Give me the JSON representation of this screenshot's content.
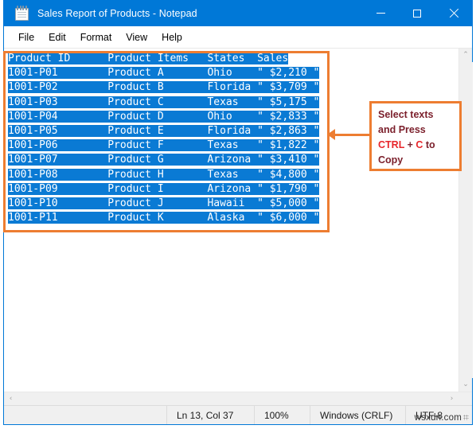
{
  "window": {
    "title": "Sales Report of Products - Notepad",
    "icon": "notepad-icon",
    "controls": {
      "minimize": "minimize-icon",
      "maximize": "maximize-icon",
      "close": "close-icon"
    }
  },
  "menubar": {
    "items": [
      {
        "label": "File"
      },
      {
        "label": "Edit"
      },
      {
        "label": "Format"
      },
      {
        "label": "View"
      },
      {
        "label": "Help"
      }
    ]
  },
  "editor": {
    "header_line": "Product ID      Product Items   States  Sales",
    "lines": [
      "Product ID      Product Items   States  Sales",
      "1001-P01        Product A       Ohio    \" $2,210 \"",
      "1001-P02        Product B       Florida \" $3,709 \"",
      "1001-P03        Product C       Texas   \" $5,175 \"",
      "1001-P04        Product D       Ohio    \" $2,833 \"",
      "1001-P05        Product E       Florida \" $2,863 \"",
      "1001-P06        Product F       Texas   \" $1,822 \"",
      "1001-P07        Product G       Arizona \" $3,410 \"",
      "1001-P08        Product H       Texas   \" $4,800 \"",
      "1001-P09        Product I       Arizona \" $1,790 \"",
      "1001-P10        Product J       Hawaii  \" $5,000 \"",
      "1001-P11        Product K       Alaska  \" $6,000 \""
    ],
    "table": {
      "columns": [
        "Product ID",
        "Product Items",
        "States",
        "Sales"
      ],
      "rows": [
        [
          "1001-P01",
          "Product A",
          "Ohio",
          "\" $2,210 \""
        ],
        [
          "1001-P02",
          "Product B",
          "Florida",
          "\" $3,709 \""
        ],
        [
          "1001-P03",
          "Product C",
          "Texas",
          "\" $5,175 \""
        ],
        [
          "1001-P04",
          "Product D",
          "Ohio",
          "\" $2,833 \""
        ],
        [
          "1001-P05",
          "Product E",
          "Florida",
          "\" $2,863 \""
        ],
        [
          "1001-P06",
          "Product F",
          "Texas",
          "\" $1,822 \""
        ],
        [
          "1001-P07",
          "Product G",
          "Arizona",
          "\" $3,410 \""
        ],
        [
          "1001-P08",
          "Product H",
          "Texas",
          "\" $4,800 \""
        ],
        [
          "1001-P09",
          "Product I",
          "Arizona",
          "\" $1,790 \""
        ],
        [
          "1001-P10",
          "Product J",
          "Hawaii",
          "\" $5,000 \""
        ],
        [
          "1001-P11",
          "Product K",
          "Alaska",
          "\" $6,000 \""
        ]
      ]
    },
    "selection": {
      "active": true,
      "highlight_color": "#0a7ad4",
      "text_color": "#ffffff"
    }
  },
  "scrollbars": {
    "vertical": {
      "up": "⌃",
      "down": "⌄"
    },
    "horizontal": {
      "left": "‹",
      "right": "›"
    }
  },
  "statusbar": {
    "position": "Ln 13, Col 37",
    "zoom": "100%",
    "line_ending": "Windows (CRLF)",
    "encoding": "UTF-8"
  },
  "watermark": {
    "text": "wsxdn.com"
  },
  "annotation": {
    "accent_color": "#ED7D31",
    "text_color": "#7B1F2B",
    "hot_color": "#E8262B",
    "line1": "Select texts",
    "line2": "and Press",
    "line3_a": "CTRL",
    "line3_b": " + ",
    "line3_c": "C",
    "line3_d": " to",
    "line4": "Copy"
  }
}
